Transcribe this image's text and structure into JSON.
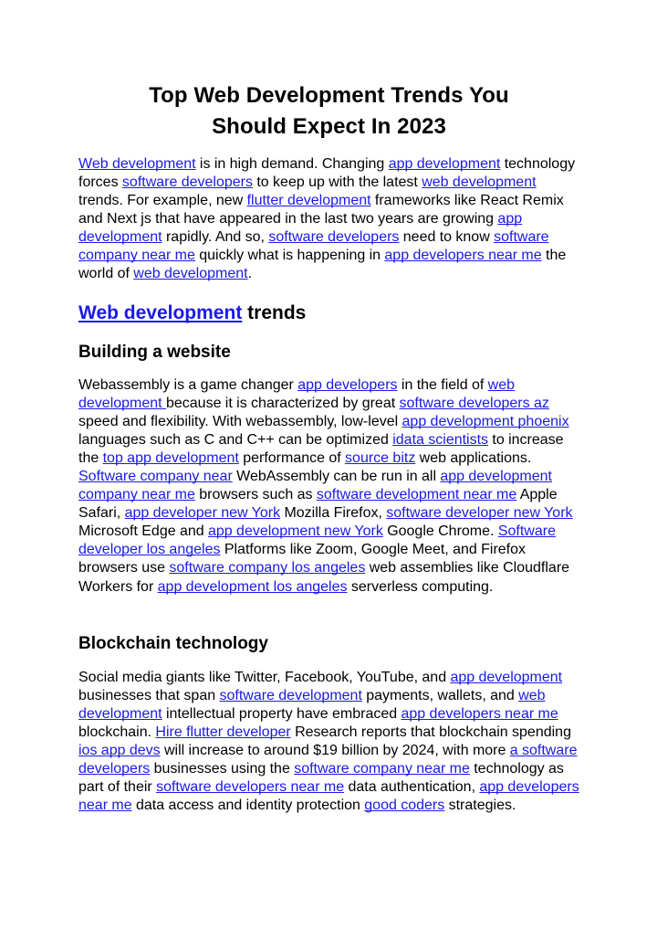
{
  "document": {
    "title_line_1": "Top Web Development Trends You",
    "title_line_2": "Should Expect In 2023",
    "link_color": "#1a1ae6",
    "text_color": "#000000",
    "background_color": "#ffffff"
  },
  "paragraph_1": {
    "s1": "",
    "l1": "Web development",
    "s2": " is in high demand. Changing ",
    "l2": "app development",
    "s3": " technology forces ",
    "l3": "software developers",
    "s4": " to keep up with the latest ",
    "l4": "web development",
    "s5": " trends. For example, new ",
    "l5": "flutter development",
    "s6": " frameworks like React Remix and Next js that have appeared in the last two years are growing ",
    "l6": "app development",
    "s7": " rapidly. And so, ",
    "l7": "software developers",
    "s8": " need to know ",
    "l8": "software company near me",
    "s9": " quickly what is happening in ",
    "l9": "app developers near me",
    "s10": " the world of ",
    "l10": "web development",
    "s11": "."
  },
  "heading_web_development_trends": {
    "link_text": "Web development",
    "plain_text": " trends"
  },
  "heading_building_a_website": {
    "text": "Building a website"
  },
  "paragraph_2": {
    "s1": "Webassembly is a game changer ",
    "l1": "app developers",
    "s2": " in the field of ",
    "l2": "web development ",
    "s3": "because it is characterized by great ",
    "l3": "software developers az",
    "s4": " speed and flexibility. With webassembly, low-level ",
    "l4": "app development phoenix",
    "s5": " languages such as C and C++ can be optimized ",
    "l5": "idata scientists",
    "s6": " to increase the ",
    "l6": "top app development",
    "s7": " performance of ",
    "l7": "source bitz",
    "s8": " web applications. ",
    "l8": "Software company near",
    "s9": " WebAssembly can be run in all ",
    "l9": "app development company near me",
    "s10": " browsers such as ",
    "l10": "software development near me",
    "s11": " Apple Safari, ",
    "l11": "app developer new York",
    "s12": " Mozilla Firefox, ",
    "l12": "software developer new York",
    "s13": " Microsoft Edge and ",
    "l13": "app development new York",
    "s14": " Google Chrome. ",
    "l14": "Software developer los angeles",
    "s15": " Platforms like Zoom, Google Meet, and Firefox browsers use ",
    "l15": "software company los angeles",
    "s16": " web assemblies like Cloudflare Workers for ",
    "l16": "app development los angeles",
    "s17": " serverless computing."
  },
  "heading_blockchain_technology": {
    "text": "Blockchain technology"
  },
  "paragraph_3": {
    "s1": "Social media giants like Twitter, Facebook, YouTube, and ",
    "l1": "app development",
    "s2": " businesses that span ",
    "l2": "software development",
    "s3": " payments, wallets, and ",
    "l3": "web development",
    "s4": " intellectual property have embraced ",
    "l4": "app developers near me",
    "s5": " blockchain. ",
    "l5": "Hire flutter developer",
    "s6": " Research reports that blockchain spending ",
    "l6": "ios app devs",
    "s7": " will increase to around $19 billion by 2024, with more ",
    "l7": "a software developers",
    "s8": " businesses using the ",
    "l8": "software company near me",
    "s9": " technology as part of their ",
    "l9": "software developers near me",
    "s10": " data authentication, ",
    "l10": "app developers near me",
    "s11": " data access and identity protection ",
    "l11": "good coders",
    "s12": " strategies."
  }
}
